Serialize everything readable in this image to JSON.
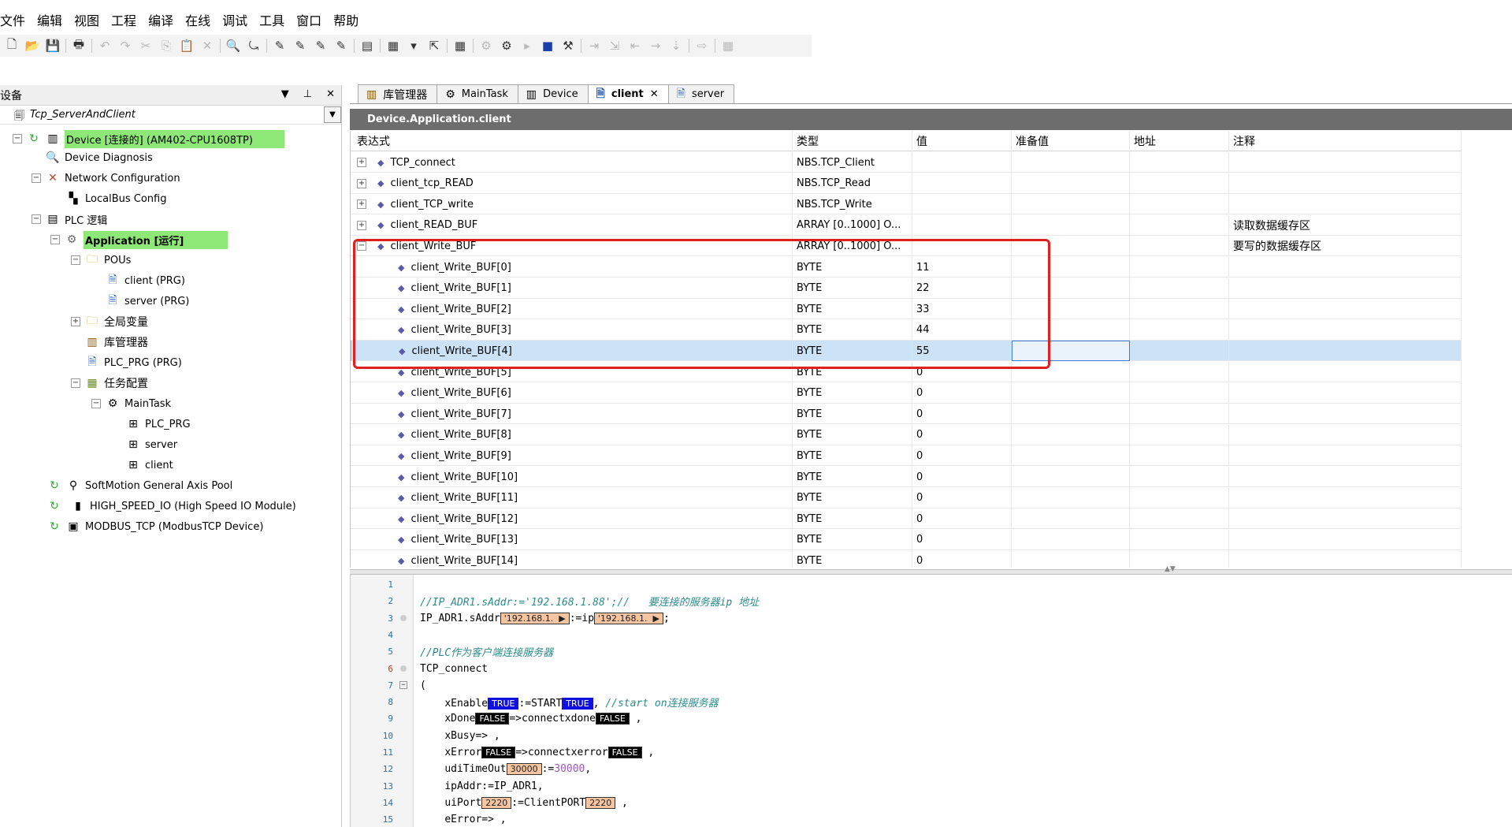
{
  "menu": [
    "文件",
    "编辑",
    "视图",
    "工程",
    "编译",
    "在线",
    "调试",
    "工具",
    "窗口",
    "帮助"
  ],
  "left_panel": {
    "title": "设备",
    "project": "Tcp_ServerAndClient",
    "tree": [
      {
        "label": "Device [连接的] (AM402-CPU1608TP)",
        "icon": "plc-device-icon"
      },
      {
        "label": "Device Diagnosis",
        "icon": "diagnosis-icon"
      },
      {
        "label": "Network Configuration",
        "icon": "network-icon"
      },
      {
        "label": "LocalBus Config",
        "icon": "localbus-icon"
      },
      {
        "label": "PLC 逻辑",
        "icon": "plc-logic-icon"
      },
      {
        "label": "Application [运行]",
        "icon": "application-icon"
      },
      {
        "label": "POUs",
        "icon": "folder-icon"
      },
      {
        "label": "client (PRG)",
        "icon": "program-icon"
      },
      {
        "label": "server (PRG)",
        "icon": "program-icon"
      },
      {
        "label": "全局变量",
        "icon": "folder-icon"
      },
      {
        "label": "库管理器",
        "icon": "library-icon"
      },
      {
        "label": "PLC_PRG (PRG)",
        "icon": "program-icon"
      },
      {
        "label": "任务配置",
        "icon": "task-config-icon"
      },
      {
        "label": "MainTask",
        "icon": "task-icon"
      },
      {
        "label": "PLC_PRG",
        "icon": "task-call-icon"
      },
      {
        "label": "server",
        "icon": "task-call-icon"
      },
      {
        "label": "client",
        "icon": "task-call-icon"
      },
      {
        "label": "SoftMotion General Axis Pool",
        "icon": "axis-pool-icon"
      },
      {
        "label": "HIGH_SPEED_IO (High Speed IO Module)",
        "icon": "io-module-icon"
      },
      {
        "label": "MODBUS_TCP (ModbusTCP Device)",
        "icon": "modbus-icon"
      }
    ]
  },
  "tabs": [
    {
      "label": "库管理器",
      "active": false
    },
    {
      "label": "MainTask",
      "active": false
    },
    {
      "label": "Device",
      "active": false
    },
    {
      "label": "client",
      "active": true
    },
    {
      "label": "server",
      "active": false
    }
  ],
  "path": "Device.Application.client",
  "watch": {
    "columns": [
      "表达式",
      "类型",
      "值",
      "准备值",
      "地址",
      "注释"
    ],
    "rows": [
      {
        "expr": "TCP_connect",
        "type": "NBS.TCP_Client",
        "value": "",
        "comment": ""
      },
      {
        "expr": "client_tcp_READ",
        "type": "NBS.TCP_Read",
        "value": "",
        "comment": ""
      },
      {
        "expr": "client_TCP_write",
        "type": "NBS.TCP_Write",
        "value": "",
        "comment": ""
      },
      {
        "expr": "client_READ_BUF",
        "type": "ARRAY [0..1000] O...",
        "value": "",
        "comment": "读取数据缓存区"
      },
      {
        "expr": "client_Write_BUF",
        "type": "ARRAY [0..1000] O...",
        "value": "",
        "comment": "要写的数据缓存区"
      },
      {
        "expr": "client_Write_BUF[0]",
        "type": "BYTE",
        "value": "11",
        "comment": ""
      },
      {
        "expr": "client_Write_BUF[1]",
        "type": "BYTE",
        "value": "22",
        "comment": ""
      },
      {
        "expr": "client_Write_BUF[2]",
        "type": "BYTE",
        "value": "33",
        "comment": ""
      },
      {
        "expr": "client_Write_BUF[3]",
        "type": "BYTE",
        "value": "44",
        "comment": ""
      },
      {
        "expr": "client_Write_BUF[4]",
        "type": "BYTE",
        "value": "55",
        "comment": ""
      },
      {
        "expr": "client_Write_BUF[5]",
        "type": "BYTE",
        "value": "0",
        "comment": ""
      },
      {
        "expr": "client_Write_BUF[6]",
        "type": "BYTE",
        "value": "0",
        "comment": ""
      },
      {
        "expr": "client_Write_BUF[7]",
        "type": "BYTE",
        "value": "0",
        "comment": ""
      },
      {
        "expr": "client_Write_BUF[8]",
        "type": "BYTE",
        "value": "0",
        "comment": ""
      },
      {
        "expr": "client_Write_BUF[9]",
        "type": "BYTE",
        "value": "0",
        "comment": ""
      },
      {
        "expr": "client_Write_BUF[10]",
        "type": "BYTE",
        "value": "0",
        "comment": ""
      },
      {
        "expr": "client_Write_BUF[11]",
        "type": "BYTE",
        "value": "0",
        "comment": ""
      },
      {
        "expr": "client_Write_BUF[12]",
        "type": "BYTE",
        "value": "0",
        "comment": ""
      },
      {
        "expr": "client_Write_BUF[13]",
        "type": "BYTE",
        "value": "0",
        "comment": ""
      },
      {
        "expr": "client_Write_BUF[14]",
        "type": "BYTE",
        "value": "0",
        "comment": ""
      }
    ]
  },
  "code": {
    "line_numbers": [
      "1",
      "2",
      "3",
      "4",
      "5",
      "6",
      "7",
      "8",
      "9",
      "10",
      "11",
      "12",
      "13",
      "14",
      "15"
    ],
    "l2_comment": "//IP_ADR1.sAddr:='192.168.1.88';//   要连接的服务器ip 地址",
    "l3_a": "IP_ADR1.sAddr",
    "l3_v1": "'192.168.1.  ▶",
    "l3_b": ":=ip",
    "l3_v2": "'192.168.1.  ▶",
    "l3_c": ";",
    "l5_comment": "//PLC作为客户端连接服务器",
    "l6": "TCP_connect",
    "l7": "(",
    "l8_a": "xEnable",
    "l8_v1": "TRUE",
    "l8_b": ":=START",
    "l8_v2": "TRUE",
    "l8_c": ",",
    "l8_comment": "//start on连接服务器",
    "l9_a": "xDone",
    "l9_v1": "FALSE",
    "l9_b": "=>connectxdone",
    "l9_v2": "FALSE",
    "l9_c": ",",
    "l10": "xBusy=> ,",
    "l11_a": "xError",
    "l11_v1": "FALSE",
    "l11_b": "=>connectxerror",
    "l11_v2": "FALSE",
    "l11_c": ",",
    "l12_a": "udiTimeOut",
    "l12_v1": "30000",
    "l12_b": ":=",
    "l12_num": "30000",
    "l12_c": ",",
    "l13": "ipAddr:=IP_ADR1,",
    "l14_a": "uiPort",
    "l14_v1": "2220",
    "l14_b": ":=ClientPORT",
    "l14_v2": "2220",
    "l14_c": ",",
    "l15": "eError=> ,"
  }
}
